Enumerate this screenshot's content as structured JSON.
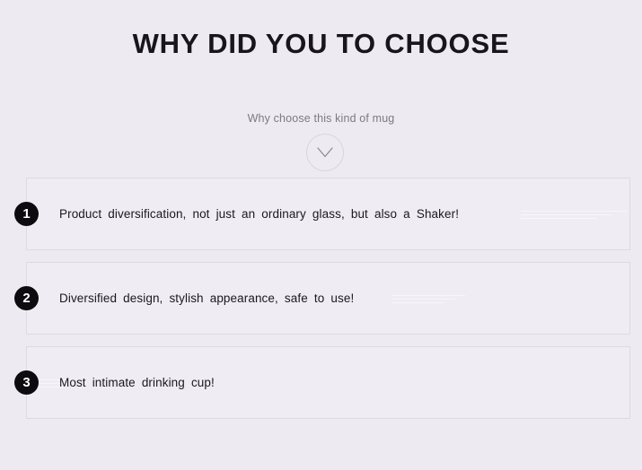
{
  "header": {
    "title": "WHY DID YOU TO CHOOSE",
    "subtitle": "Why choose this kind of mug"
  },
  "expander": {
    "icon": "chevron-down-icon",
    "color": "#8a8893",
    "border_color": "#d8d6dd"
  },
  "colors": {
    "background": "#edebf1",
    "box_background": "#efedf3",
    "box_border": "#dcdae2",
    "badge_background": "#0d0b10",
    "badge_text": "#ffffff",
    "title_text": "#18161c",
    "subtitle_text": "#7b7a85",
    "body_text": "#191720"
  },
  "features": [
    {
      "number": "1",
      "text": "Product  diversification,  not  just  an  ordinary  glass,  but  also  a  Shaker!"
    },
    {
      "number": "2",
      "text": "Diversified  design,  stylish  appearance,  safe  to  use!"
    },
    {
      "number": "3",
      "text": "Most  intimate  drinking  cup!"
    }
  ]
}
